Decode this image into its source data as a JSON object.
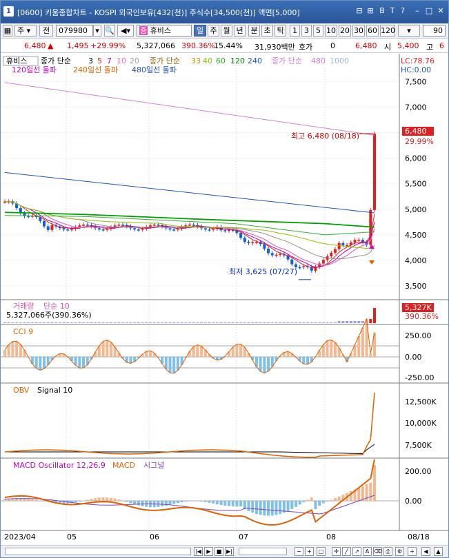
{
  "titlebar": {
    "num": "1",
    "title": "[0600] 키움종합차트 - KOSPI 외국인보유[432(천)] 주식수[34,500(천)] 액면[5,000]",
    "icons": [
      "restore-icon",
      "save-icon",
      "bold-icon",
      "font-icon",
      "help-icon",
      "minimize-icon",
      "maximize-icon",
      "close-icon"
    ],
    "icon_glyphs": [
      "⊟",
      "⊞",
      "B",
      "T",
      "?",
      "–",
      "□",
      "✕"
    ]
  },
  "toolbar": {
    "market": "주",
    "prev_label": "전",
    "code": "079980",
    "name": "휴비스",
    "periods": [
      "일",
      "주",
      "월",
      "년",
      "분",
      "초",
      "틱"
    ],
    "selected_period": "일",
    "intervals": [
      "1",
      "3",
      "5",
      "10",
      "20",
      "30",
      "60",
      "120"
    ],
    "count": "90"
  },
  "quote": {
    "price": "6,480",
    "change": "1,495",
    "rate": "+29.99%",
    "volume": "5,327,066",
    "vol_rate": "390.36%",
    "turnover": "15.44%",
    "amount": "31,930백만",
    "bid_label": "호가",
    "bid_value": "0",
    "ask_value": "6,480",
    "open_label": "시",
    "open_value": "5,400",
    "high_label": "고",
    "high_value": "6"
  },
  "price_panel": {
    "stock_label": "휴비스",
    "ma_title": "종가 단순",
    "ma_periods": [
      "3",
      "5",
      "7",
      "10",
      "20"
    ],
    "ma_title2": "종가 단순",
    "ma_periods2": [
      "33",
      "40",
      "60",
      "120",
      "240"
    ],
    "ma_title3": "종가 단순",
    "ma_periods3": [
      "480",
      "1000"
    ],
    "break_labels": [
      "120일선 돌파",
      "240일선 돌파",
      "480일선 돌파"
    ],
    "lc": "LC:78.76",
    "hc": "HC:0.00",
    "high_note": "최고 6,480 (08/18)",
    "low_note": "최저 3,625 (07/27)",
    "last_price": "6,480",
    "last_rate": "29.99%",
    "axis": [
      "7,500",
      "7,000",
      "6,500",
      "6,000",
      "5,500",
      "5,000",
      "4,500",
      "4,000",
      "3,500"
    ],
    "colors": {
      "up": "#e02020",
      "down": "#1060d0"
    }
  },
  "volume_panel": {
    "title": "거래량",
    "title2": "단순 10",
    "value": "5,327,066주(390.36%)",
    "last": "5,327K",
    "last_rate": "390.36%"
  },
  "cci_panel": {
    "title": "CCI 9",
    "axis": [
      "250.00",
      "0.00",
      "-250.00"
    ]
  },
  "obv_panel": {
    "title": "OBV",
    "title2": "Signal 10",
    "axis": [
      "12,500K",
      "10,000K",
      "7,500K"
    ]
  },
  "macd_panel": {
    "title": "MACD Oscillator 12,26,9",
    "title2": "MACD",
    "title3": "시그널",
    "axis": [
      "200.00",
      "0.00"
    ]
  },
  "x_axis": {
    "labels": [
      "2023/04",
      "05",
      "06",
      "07",
      "08"
    ],
    "last": "08/18"
  },
  "chart_data": {
    "type": "candlestick",
    "ylim": [
      3300,
      7800
    ],
    "last_close": 6480,
    "high": 6480,
    "low": 3625
  }
}
